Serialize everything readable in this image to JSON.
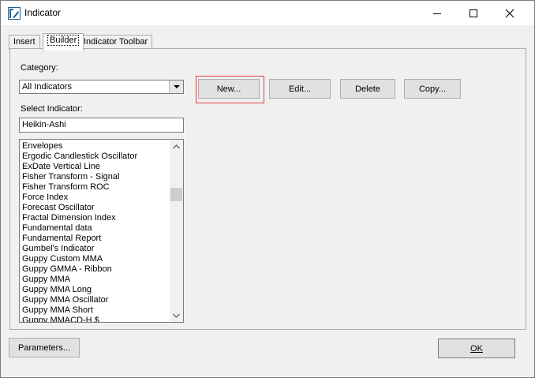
{
  "window": {
    "title": "Indicator",
    "icon": "indicator-app-icon",
    "minimize_icon": "minimize-icon",
    "maximize_icon": "maximize-icon",
    "close_icon": "close-icon"
  },
  "tabs": [
    {
      "label": "Insert",
      "active": false
    },
    {
      "label": "Builder",
      "active": true
    },
    {
      "label": "Indicator Toolbar",
      "active": false
    }
  ],
  "builder": {
    "category_label": "Category:",
    "category_value": "All Indicators",
    "select_indicator_label": "Select Indicator:",
    "indicator_search_value": "Heikin-Ashi",
    "indicators": [
      "Envelopes",
      "Ergodic Candlestick Oscillator",
      "ExDate Vertical Line",
      "Fisher Transform - Signal",
      "Fisher Transform ROC",
      "Force Index",
      "Forecast Oscillator",
      "Fractal Dimension Index",
      "Fundamental data",
      "Fundamental Report",
      "Gumbel's Indicator",
      "Guppy Custom MMA",
      "Guppy GMMA - Ribbon",
      "Guppy MMA",
      "Guppy MMA Long",
      "Guppy MMA Oscillator",
      "Guppy MMA Short",
      "Guppy MMACD-H $"
    ],
    "buttons": {
      "new": "New...",
      "edit": "Edit...",
      "delete": "Delete",
      "copy": "Copy..."
    }
  },
  "footer": {
    "parameters": "Parameters...",
    "ok": "OK"
  },
  "colors": {
    "highlight": "#e04040"
  }
}
